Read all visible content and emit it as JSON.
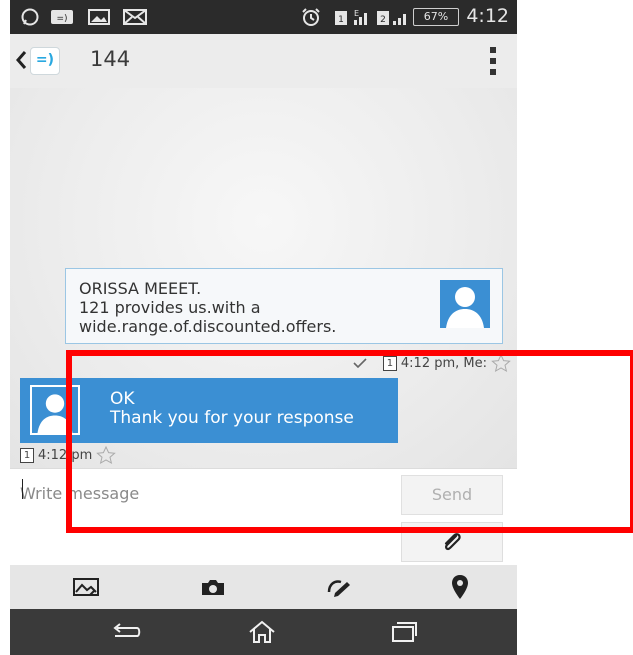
{
  "status_bar": {
    "battery": "67%",
    "time": "4:12",
    "sim1": "1",
    "sim2": "2"
  },
  "header": {
    "app_logo": "=)",
    "title": "144",
    "back_icon": "chevron-left-icon",
    "menu_icon": "overflow-menu-icon"
  },
  "messages": [
    {
      "direction": "incoming",
      "lines": [
        "ORISSA MEEET.",
        "121 provides us.with a",
        "wide.range.of.discounted.offers."
      ],
      "sim": "1",
      "meta": "4:12 pm, Me:"
    },
    {
      "direction": "outgoing",
      "lines": [
        "OK",
        "Thank you for your response"
      ],
      "sim": "1",
      "meta": "4:12 pm"
    }
  ],
  "compose": {
    "placeholder": "Write message",
    "send_label": "Send",
    "attach_icon": "paperclip-icon"
  },
  "media_bar": {
    "icons": [
      "gallery-icon",
      "camera-icon",
      "sketch-icon",
      "location-pin-icon"
    ]
  },
  "nav_bar": {
    "icons": [
      "back-icon",
      "home-icon",
      "recents-icon"
    ]
  },
  "colors": {
    "accent": "#3b8fd3",
    "highlight": "#ff0000",
    "statusbar": "#2b2b2b",
    "navbar": "#3a3a3a"
  }
}
